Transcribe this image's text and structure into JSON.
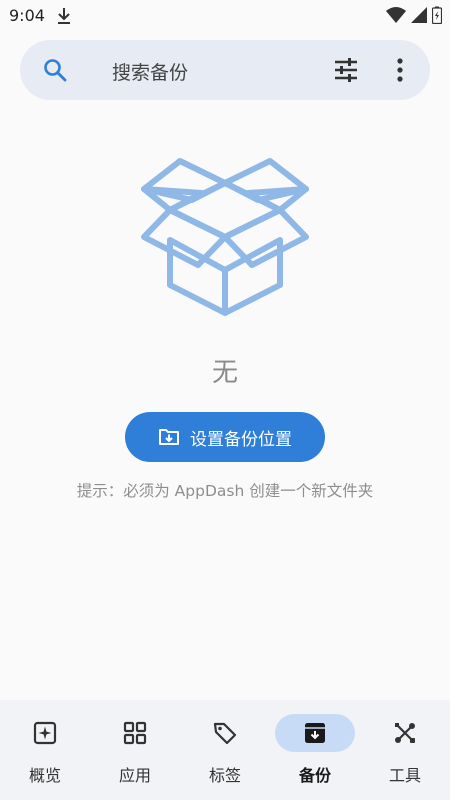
{
  "status_bar": {
    "time": "9:04"
  },
  "search": {
    "placeholder": "搜索备份"
  },
  "empty_state": {
    "label": "无",
    "button_label": "设置备份位置",
    "hint": "提示：必须为 AppDash 创建一个新文件夹"
  },
  "bottom_nav": {
    "items": [
      {
        "label": "概览",
        "icon": "overview-icon"
      },
      {
        "label": "应用",
        "icon": "apps-grid-icon"
      },
      {
        "label": "标签",
        "icon": "tags-icon"
      },
      {
        "label": "备份",
        "icon": "archive-icon",
        "active": true
      },
      {
        "label": "工具",
        "icon": "tools-icon"
      }
    ]
  },
  "colors": {
    "accent": "#2f7fd8",
    "illustration": "#8fb8e6",
    "active_pill": "#c8dbf6",
    "search_bg": "#e7ebf3"
  }
}
